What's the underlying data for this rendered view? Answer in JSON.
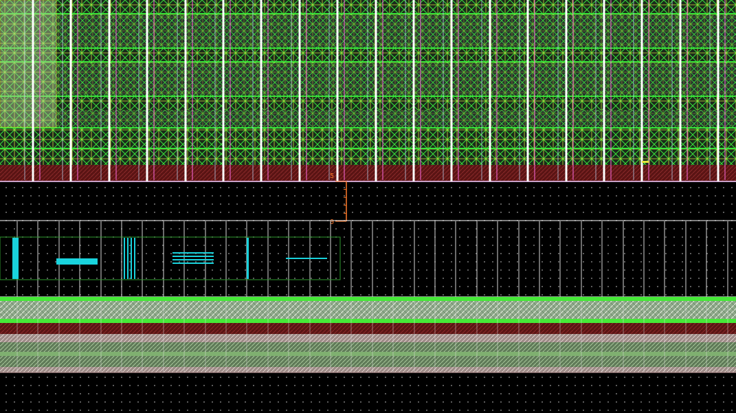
{
  "ruler": {
    "top_label": "5",
    "bottom_label": "0"
  },
  "colors": {
    "background": "#000000",
    "metal_green": "#39e23a",
    "metal_yellow": "#e2e23a",
    "via_grid": "#2f3a3a",
    "power_rail_white": "#ffffff",
    "pink_rail": "#ff6adf",
    "cyan_shape": "#19d3dd",
    "dark_red": "#4a0d0d",
    "ruler": "#ff7a2a",
    "outline_green": "#2e9a2e"
  },
  "shapes": {
    "cyan_rect_count": 6
  }
}
